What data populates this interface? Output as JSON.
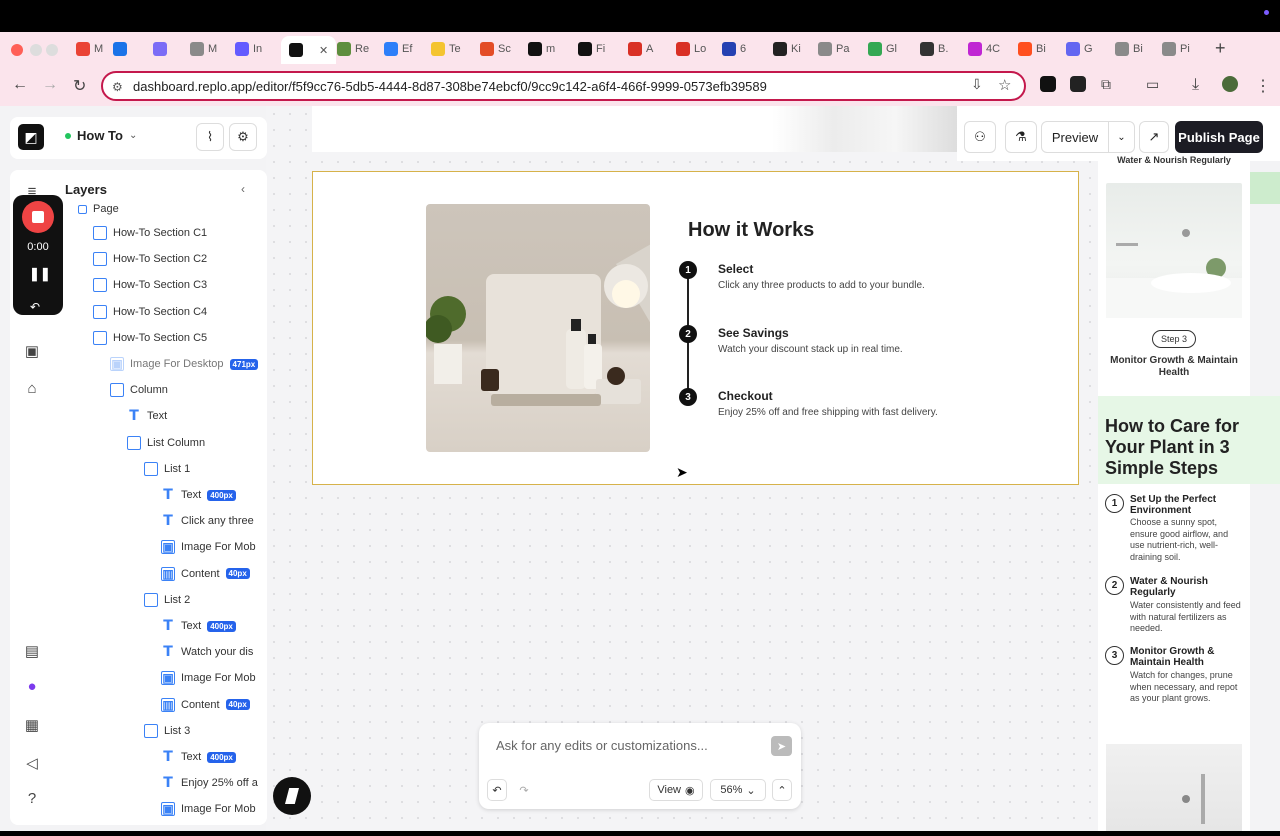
{
  "browser": {
    "tabs": [
      {
        "label": "M",
        "color": "#ea4335"
      },
      {
        "label": "",
        "color": "#1a73e8"
      },
      {
        "label": "",
        "color": "#7b6cf6"
      },
      {
        "label": "M",
        "color": "#8a8a8a"
      },
      {
        "label": "In",
        "color": "#635bff"
      },
      {
        "label": "",
        "color": "#111111"
      },
      {
        "label": "Re",
        "color": "#5e8e3e"
      },
      {
        "label": "Ef",
        "color": "#2d7ff9"
      },
      {
        "label": "Te",
        "color": "#f4c430"
      },
      {
        "label": "Sc",
        "color": "#e34c26"
      },
      {
        "label": "m",
        "color": "#111111"
      },
      {
        "label": "Fi",
        "color": "#111111"
      },
      {
        "label": "A",
        "color": "#d93025"
      },
      {
        "label": "Lo",
        "color": "#d93025"
      },
      {
        "label": "6",
        "color": "#2541b2"
      },
      {
        "label": "Ki",
        "color": "#222222"
      },
      {
        "label": "Pa",
        "color": "#8a8a8a"
      },
      {
        "label": "Gl",
        "color": "#34a853"
      },
      {
        "label": "B.",
        "color": "#333333"
      },
      {
        "label": "4C",
        "color": "#c026d3"
      },
      {
        "label": "Bi",
        "color": "#ff4f1f"
      },
      {
        "label": "G",
        "color": "#6366f1"
      },
      {
        "label": "Bi",
        "color": "#8a8a8a"
      },
      {
        "label": "Pi",
        "color": "#8a8a8a"
      }
    ],
    "url": "dashboard.replo.app/editor/f5f9cc76-5db5-4444-8d87-308be74ebcf0/9cc9c142-a6f4-466f-9999-0573efb39589"
  },
  "editor": {
    "page_name": "How To",
    "layers_title": "Layers",
    "publish_label": "Publish Page",
    "preview_label": "Preview",
    "recorder_time": "0:00",
    "layers": [
      {
        "label": "Page",
        "type": "page",
        "level": 0
      },
      {
        "label": "How-To Section C1",
        "type": "box",
        "level": 0
      },
      {
        "label": "How-To Section C2",
        "type": "box",
        "level": 0
      },
      {
        "label": "How-To Section C3",
        "type": "box",
        "level": 0
      },
      {
        "label": "How-To Section C4",
        "type": "box",
        "level": 0
      },
      {
        "label": "How-To Section C5",
        "type": "box",
        "level": 0
      },
      {
        "label": "Image For Desktop",
        "type": "img-faded",
        "level": 1,
        "badge": "471px"
      },
      {
        "label": "Column",
        "type": "box",
        "level": 1
      },
      {
        "label": "Text",
        "type": "text",
        "level": 2
      },
      {
        "label": "List Column",
        "type": "box",
        "level": 2
      },
      {
        "label": "List 1",
        "type": "box",
        "level": 3
      },
      {
        "label": "Text",
        "type": "text",
        "level": 4,
        "badge": "400px"
      },
      {
        "label": "Click any three",
        "type": "text",
        "level": 4
      },
      {
        "label": "Image For Mob",
        "type": "img",
        "level": 4
      },
      {
        "label": "Content",
        "type": "content",
        "level": 4,
        "badge": "40px"
      },
      {
        "label": "List 2",
        "type": "box",
        "level": 3
      },
      {
        "label": "Text",
        "type": "text",
        "level": 4,
        "badge": "400px"
      },
      {
        "label": "Watch your dis",
        "type": "text",
        "level": 4
      },
      {
        "label": "Image For Mob",
        "type": "img",
        "level": 4
      },
      {
        "label": "Content",
        "type": "content",
        "level": 4,
        "badge": "40px"
      },
      {
        "label": "List 3",
        "type": "box",
        "level": 3
      },
      {
        "label": "Text",
        "type": "text",
        "level": 4,
        "badge": "400px"
      },
      {
        "label": "Enjoy 25% off a",
        "type": "text",
        "level": 4
      },
      {
        "label": "Image For Mob",
        "type": "img",
        "level": 4
      }
    ]
  },
  "section": {
    "heading": "How it Works",
    "steps": [
      {
        "num": "1",
        "title": "Select",
        "desc": "Click any three products to add to your bundle."
      },
      {
        "num": "2",
        "title": "See Savings",
        "desc": "Watch your discount stack up in real time."
      },
      {
        "num": "3",
        "title": "Checkout",
        "desc": "Enjoy 25% off and free shipping with fast delivery."
      }
    ]
  },
  "preview_panel": {
    "top_label": "Water & Nourish Regularly",
    "step_pill": "Step 3",
    "step_title": "Monitor Growth & Maintain Health",
    "heading": "How to Care for Your Plant in 3 Simple Steps",
    "steps": [
      {
        "num": "1",
        "title": "Set Up the Perfect Environment",
        "desc": "Choose a sunny spot, ensure good airflow, and use nutrient-rich, well-draining soil."
      },
      {
        "num": "2",
        "title": "Water & Nourish Regularly",
        "desc": "Water consistently and feed with natural fertilizers as needed."
      },
      {
        "num": "3",
        "title": "Monitor Growth & Maintain Health",
        "desc": "Watch for changes, prune when necessary, and repot as your plant grows."
      }
    ]
  },
  "chat": {
    "placeholder": "Ask for any edits or customizations...",
    "view_label": "View",
    "zoom": "56%"
  }
}
